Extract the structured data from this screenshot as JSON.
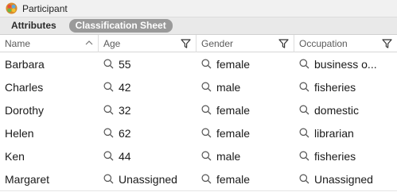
{
  "window": {
    "title": "Participant"
  },
  "tabs": [
    {
      "label": "Attributes",
      "active": false
    },
    {
      "label": "Classification Sheet",
      "active": true
    }
  ],
  "columns": [
    {
      "label": "Name",
      "icon": "chevron-up-icon"
    },
    {
      "label": "Age",
      "icon": "filter-icon"
    },
    {
      "label": "Gender",
      "icon": "filter-icon"
    },
    {
      "label": "Occupation",
      "icon": "filter-icon"
    }
  ],
  "rows": [
    {
      "name": "Barbara",
      "age": "55",
      "gender": "female",
      "occupation": "business o..."
    },
    {
      "name": "Charles",
      "age": "42",
      "gender": "male",
      "occupation": "fisheries"
    },
    {
      "name": "Dorothy",
      "age": "32",
      "gender": "female",
      "occupation": "domestic"
    },
    {
      "name": "Helen",
      "age": "62",
      "gender": "female",
      "occupation": "librarian"
    },
    {
      "name": "Ken",
      "age": "44",
      "gender": "male",
      "occupation": "fisheries"
    },
    {
      "name": "Margaret",
      "age": "Unassigned",
      "gender": "female",
      "occupation": "Unassigned"
    }
  ],
  "colors": {
    "active_tab_bg": "#9a9a9a",
    "tabbar_bg": "#e9e9e9",
    "titlebar_bg": "#f1f1f1"
  }
}
